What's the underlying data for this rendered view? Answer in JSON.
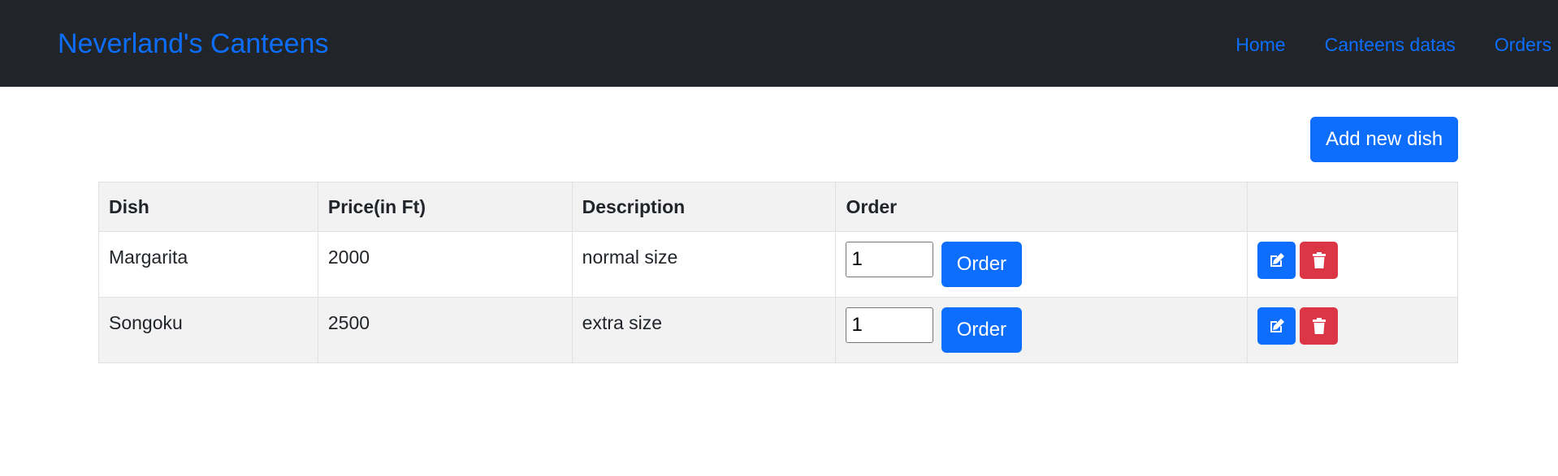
{
  "navbar": {
    "brand": "Neverland's Canteens",
    "links": [
      "Home",
      "Canteens datas",
      "Orders"
    ]
  },
  "toolbar": {
    "add_label": "Add new dish"
  },
  "table": {
    "headers": [
      "Dish",
      "Price(in Ft)",
      "Description",
      "Order",
      ""
    ],
    "rows": [
      {
        "dish": "Margarita",
        "price": "2000",
        "description": "normal size",
        "quantity": "1",
        "order_label": "Order"
      },
      {
        "dish": "Songoku",
        "price": "2500",
        "description": "extra size",
        "quantity": "1",
        "order_label": "Order"
      }
    ]
  },
  "icons": {
    "edit": "edit-icon",
    "delete": "trash-icon"
  },
  "colors": {
    "navbar_bg": "#212529",
    "primary": "#0d6efd",
    "danger": "#dc3545",
    "stripe": "#f2f2f2"
  }
}
